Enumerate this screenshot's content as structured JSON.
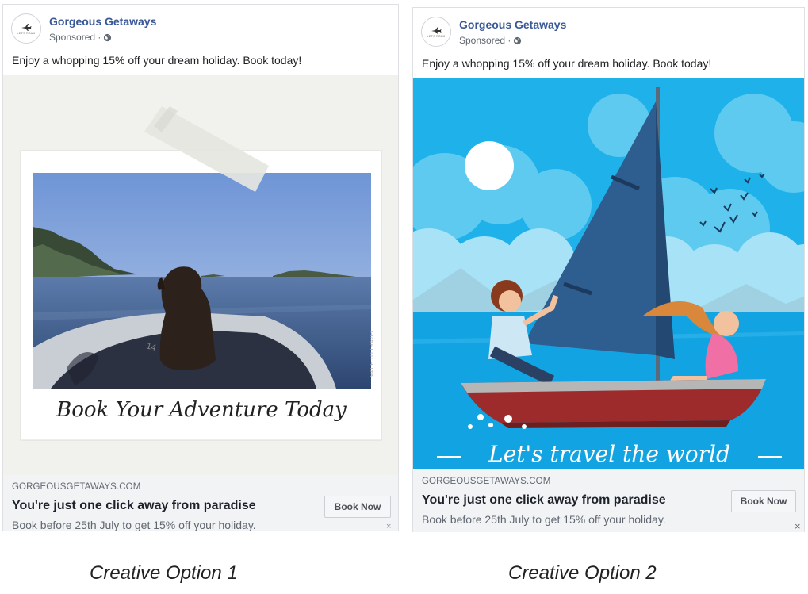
{
  "ads": [
    {
      "page_name": "Gorgeous Getaways",
      "sponsored": "Sponsored ·",
      "caption": "Enjoy a whopping 15% off your dream holiday. Book today!",
      "creative_text": "Book Your Adventure Today",
      "creative_icon": "dog-on-boat-photo",
      "domain": "GORGEOUSGETAWAYS.COM",
      "headline": "You're just one click away from paradise",
      "description": "Book before 25th July to get 15% off your holiday.",
      "cta_label": "Book Now"
    },
    {
      "page_name": "Gorgeous Getaways",
      "sponsored": "Sponsored ·",
      "caption": "Enjoy a whopping 15% off your dream holiday. Book today!",
      "creative_text": "Let's travel the world",
      "creative_icon": "sailboat-couple-illustration",
      "domain": "GORGEOUSGETAWAYS.COM",
      "headline": "You're just one click away from paradise",
      "description": "Book before 25th July to get 15% off your holiday.",
      "cta_label": "Book Now"
    }
  ],
  "logo_text": "LET'S ROAM",
  "close_glyph": "×",
  "option_labels": [
    "Creative Option 1",
    "Creative Option 2"
  ],
  "colors": {
    "page_name": "#385898",
    "sky_blue": "#1fb2ea",
    "boat_red": "#9e2b2b"
  }
}
